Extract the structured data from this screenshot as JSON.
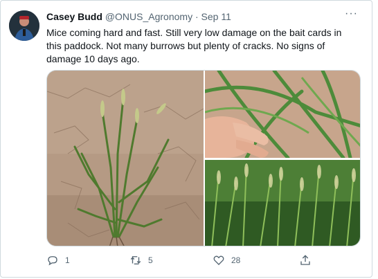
{
  "tweet": {
    "author_name": "Casey Budd",
    "author_handle": "@ONUS_Agronomy",
    "separator": "·",
    "date": "Sep 11",
    "more_label": "···",
    "text": "Mice coming hard and fast. Still very low damage on the bait cards in this paddock. Not many burrows but plenty of cracks. No signs of damage 10 days ago."
  },
  "actions": {
    "reply_count": "1",
    "retweet_count": "5",
    "like_count": "28"
  },
  "icons": {
    "reply": "reply-icon",
    "retweet": "retweet-icon",
    "like": "heart-icon",
    "share": "share-icon",
    "more": "more-icon"
  },
  "colors": {
    "text": "#0f1419",
    "secondary": "#536471",
    "border": "#cfd9de"
  }
}
